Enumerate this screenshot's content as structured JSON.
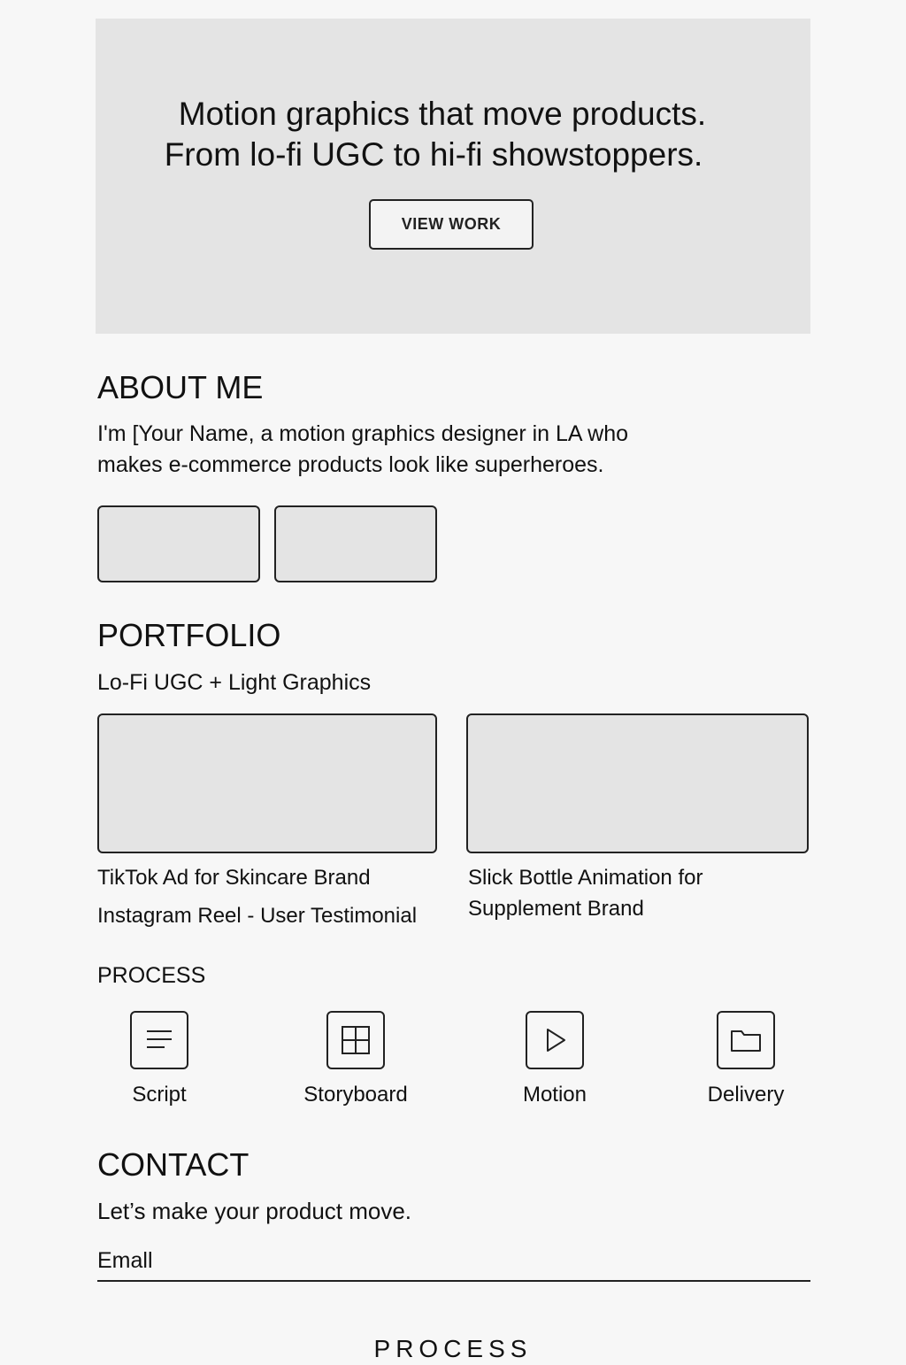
{
  "hero": {
    "line1": "Motion graphics that move products.",
    "line2": "From lo-fi UGC to hi-fi showstoppers.",
    "cta_label": "VIEW WORK"
  },
  "about": {
    "heading": "ABOUT ME",
    "line1": "I'm [Your Name, a motion graphics designer in LA who",
    "line2": "makes e-commerce products look like superheroes."
  },
  "portfolio": {
    "heading": "PORTFOLIO",
    "subheading": "Lo-Fi UGC + Light Graphics",
    "left_captions": [
      "TikTok Ad for Skincare Brand",
      "Instagram Reel - User Testimonial"
    ],
    "right_caption_line1": "Slick Bottle Animation for",
    "right_caption_line2": "Supplement Brand"
  },
  "process": {
    "heading": "PROCESS",
    "steps": [
      {
        "label": "Script",
        "icon": "script-icon"
      },
      {
        "label": "Storyboard",
        "icon": "storyboard-icon"
      },
      {
        "label": "Motion",
        "icon": "play-icon"
      },
      {
        "label": "Delivery",
        "icon": "folder-icon"
      }
    ]
  },
  "contact": {
    "heading": "CONTACT",
    "subheading": "Let’s make your product move.",
    "email_placeholder": "Emall"
  },
  "footer": {
    "label": "PROCESS"
  }
}
